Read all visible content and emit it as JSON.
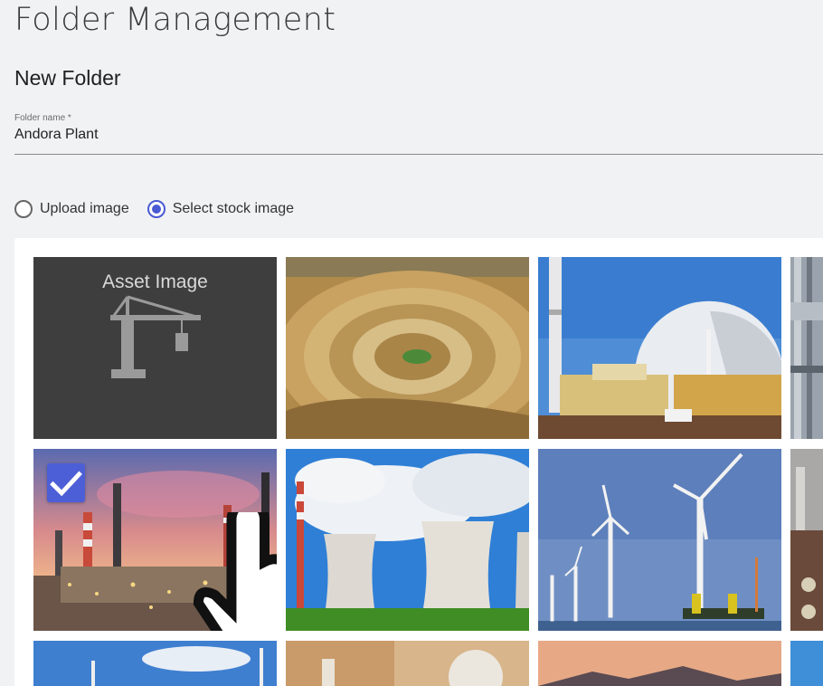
{
  "page": {
    "title": "Folder Management"
  },
  "form": {
    "section_title": "New Folder",
    "folder_name_label": "Folder name *",
    "folder_name_value": "Andora Plant"
  },
  "image_source": {
    "options": [
      {
        "label": "Upload image",
        "selected": false
      },
      {
        "label": "Select stock image",
        "selected": true
      }
    ]
  },
  "gallery": {
    "asset_tile_label": "Asset Image",
    "selected_tile": "refinery-sunset",
    "tiles": [
      "asset-placeholder",
      "open-pit-mine",
      "nuclear-dome",
      "industrial-partial",
      "refinery-sunset",
      "cooling-towers",
      "offshore-wind",
      "industrial-partial-2",
      "water-tower",
      "lab-equipment",
      "mountain-sunset",
      "sky-partial"
    ]
  },
  "colors": {
    "accent": "#4a5ad3",
    "check_badge": "#4d5fd6"
  }
}
